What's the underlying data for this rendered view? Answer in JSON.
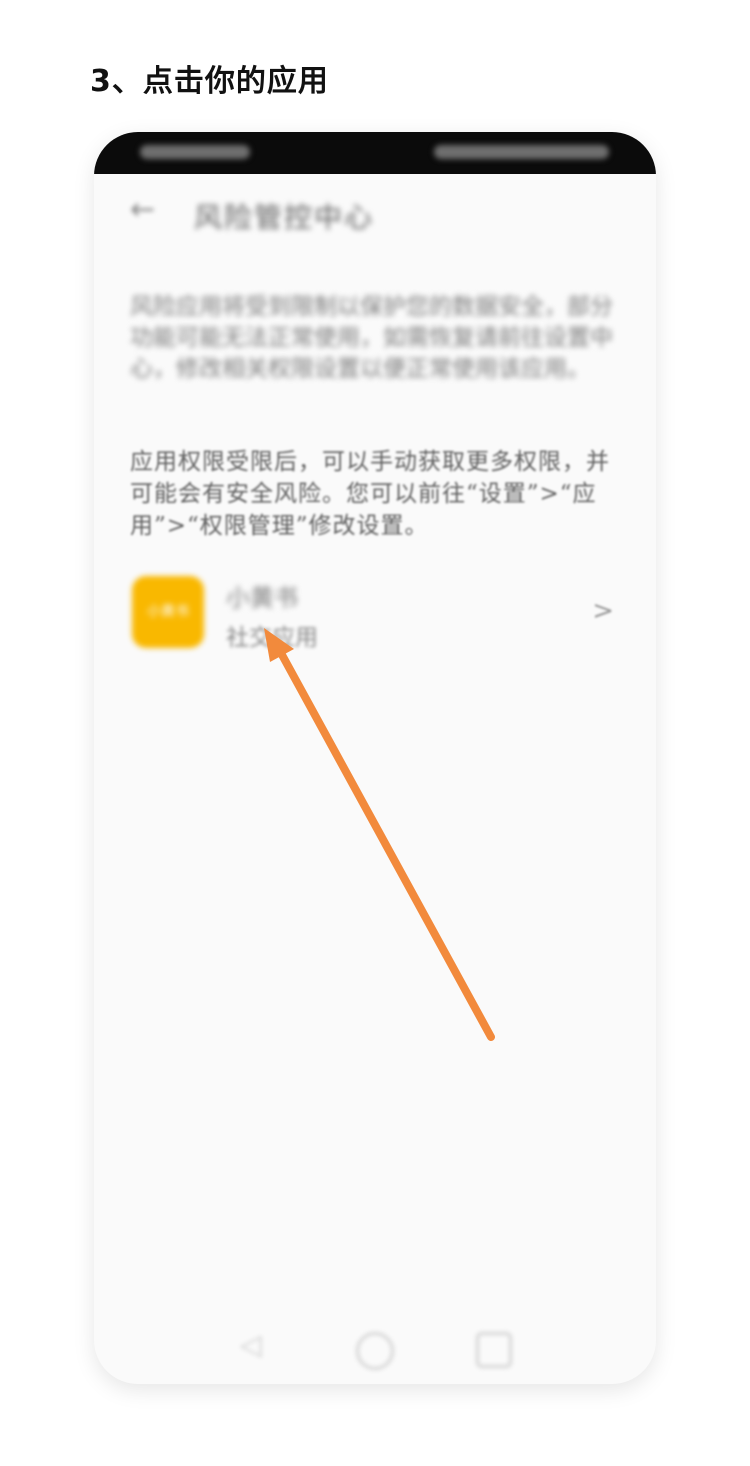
{
  "step": {
    "title": "3、点击你的应用"
  },
  "screen": {
    "title": "风险管控中心",
    "description": "应用权限受限后，可以手动获取更多权限，并可能会有安全风险。您可以前往“设置”>“应用”>“权限管理”修改设置。",
    "app": {
      "name": "小黄书",
      "type": "社交应用",
      "icon_text": "小黄书"
    }
  },
  "colors": {
    "arrow": "#f28a3c",
    "app_icon": "#f9b800",
    "accent_title": "#111111"
  },
  "icons": {
    "back": "back-arrow-icon",
    "chevron": "chevron-right-icon",
    "nav_back": "nav-back-icon",
    "nav_home": "nav-home-icon",
    "nav_recent": "nav-recent-icon"
  }
}
